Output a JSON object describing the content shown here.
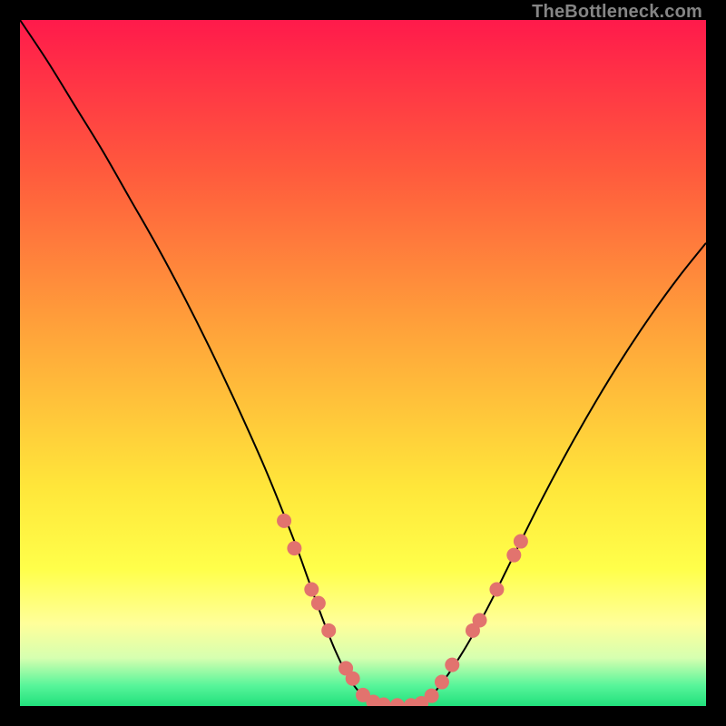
{
  "watermark": "TheBottleneck.com",
  "chart_data": {
    "type": "line",
    "title": "",
    "xlabel": "",
    "ylabel": "",
    "xlim": [
      0,
      100
    ],
    "ylim": [
      0,
      100
    ],
    "grid": false,
    "legend": false,
    "background_gradient": {
      "stops": [
        {
          "pos": 0.0,
          "color": "#ff1a4b"
        },
        {
          "pos": 0.22,
          "color": "#ff5a3d"
        },
        {
          "pos": 0.45,
          "color": "#ffa23a"
        },
        {
          "pos": 0.68,
          "color": "#ffe63a"
        },
        {
          "pos": 0.8,
          "color": "#ffff4a"
        },
        {
          "pos": 0.88,
          "color": "#ffff9a"
        },
        {
          "pos": 0.93,
          "color": "#d6ffb0"
        },
        {
          "pos": 0.97,
          "color": "#58f59a"
        },
        {
          "pos": 1.0,
          "color": "#21e07c"
        }
      ]
    },
    "series": [
      {
        "name": "bottleneck-curve",
        "color": "#000000",
        "stroke_width": 2,
        "x": [
          0,
          4,
          8,
          12,
          16,
          20,
          24,
          28,
          32,
          36,
          40,
          42,
          44,
          46,
          48,
          50,
          52,
          54,
          56,
          58,
          60,
          64,
          68,
          72,
          76,
          80,
          84,
          88,
          92,
          96,
          100
        ],
        "y": [
          100,
          94,
          87.5,
          81,
          74,
          67,
          59.5,
          51.5,
          43,
          34,
          24,
          18.5,
          13,
          8,
          4,
          1.5,
          0.3,
          0,
          0,
          0.3,
          1.5,
          7,
          14,
          22,
          30,
          37.5,
          44.5,
          51,
          57,
          62.5,
          67.5
        ]
      }
    ],
    "markers": {
      "name": "highlighted-points",
      "color": "#e2736e",
      "radius": 8,
      "points": [
        {
          "x": 38.5,
          "y": 27.0
        },
        {
          "x": 40.0,
          "y": 23.0
        },
        {
          "x": 42.5,
          "y": 17.0
        },
        {
          "x": 43.5,
          "y": 15.0
        },
        {
          "x": 45.0,
          "y": 11.0
        },
        {
          "x": 47.5,
          "y": 5.5
        },
        {
          "x": 48.5,
          "y": 4.0
        },
        {
          "x": 50.0,
          "y": 1.6
        },
        {
          "x": 51.5,
          "y": 0.6
        },
        {
          "x": 53.0,
          "y": 0.2
        },
        {
          "x": 55.0,
          "y": 0.1
        },
        {
          "x": 57.0,
          "y": 0.1
        },
        {
          "x": 58.5,
          "y": 0.4
        },
        {
          "x": 60.0,
          "y": 1.5
        },
        {
          "x": 61.5,
          "y": 3.5
        },
        {
          "x": 63.0,
          "y": 6.0
        },
        {
          "x": 66.0,
          "y": 11.0
        },
        {
          "x": 67.0,
          "y": 12.5
        },
        {
          "x": 69.5,
          "y": 17.0
        },
        {
          "x": 72.0,
          "y": 22.0
        },
        {
          "x": 73.0,
          "y": 24.0
        }
      ]
    }
  }
}
